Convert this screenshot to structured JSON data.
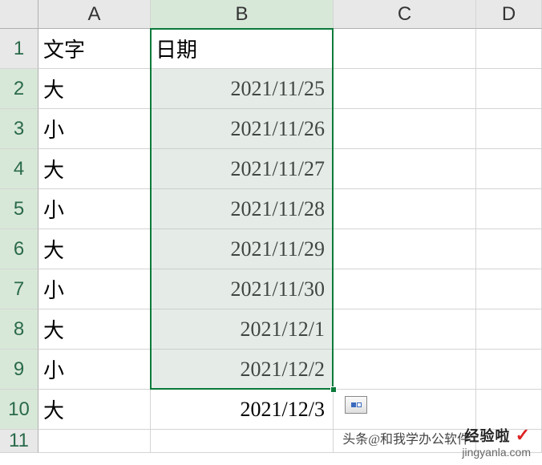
{
  "columns": [
    "A",
    "B",
    "C",
    "D"
  ],
  "rows": [
    "1",
    "2",
    "3",
    "4",
    "5",
    "6",
    "7",
    "8",
    "9",
    "10",
    "11"
  ],
  "headers": {
    "A": "文字",
    "B": "日期"
  },
  "data": {
    "A": [
      "大",
      "小",
      "大",
      "小",
      "大",
      "小",
      "大",
      "小",
      "大"
    ],
    "B": [
      "2021/11/25",
      "2021/11/26",
      "2021/11/27",
      "2021/11/28",
      "2021/11/29",
      "2021/11/30",
      "2021/12/1",
      "2021/12/2",
      "2021/12/3"
    ]
  },
  "selection": {
    "col": "B",
    "rows_from": 2,
    "rows_to": 10
  },
  "autofill_icon": "autofill-options",
  "watermark": {
    "title": "经验啦",
    "check": "✓",
    "sub": "jingyanla.com",
    "back": "头条@和我学办公软件"
  }
}
